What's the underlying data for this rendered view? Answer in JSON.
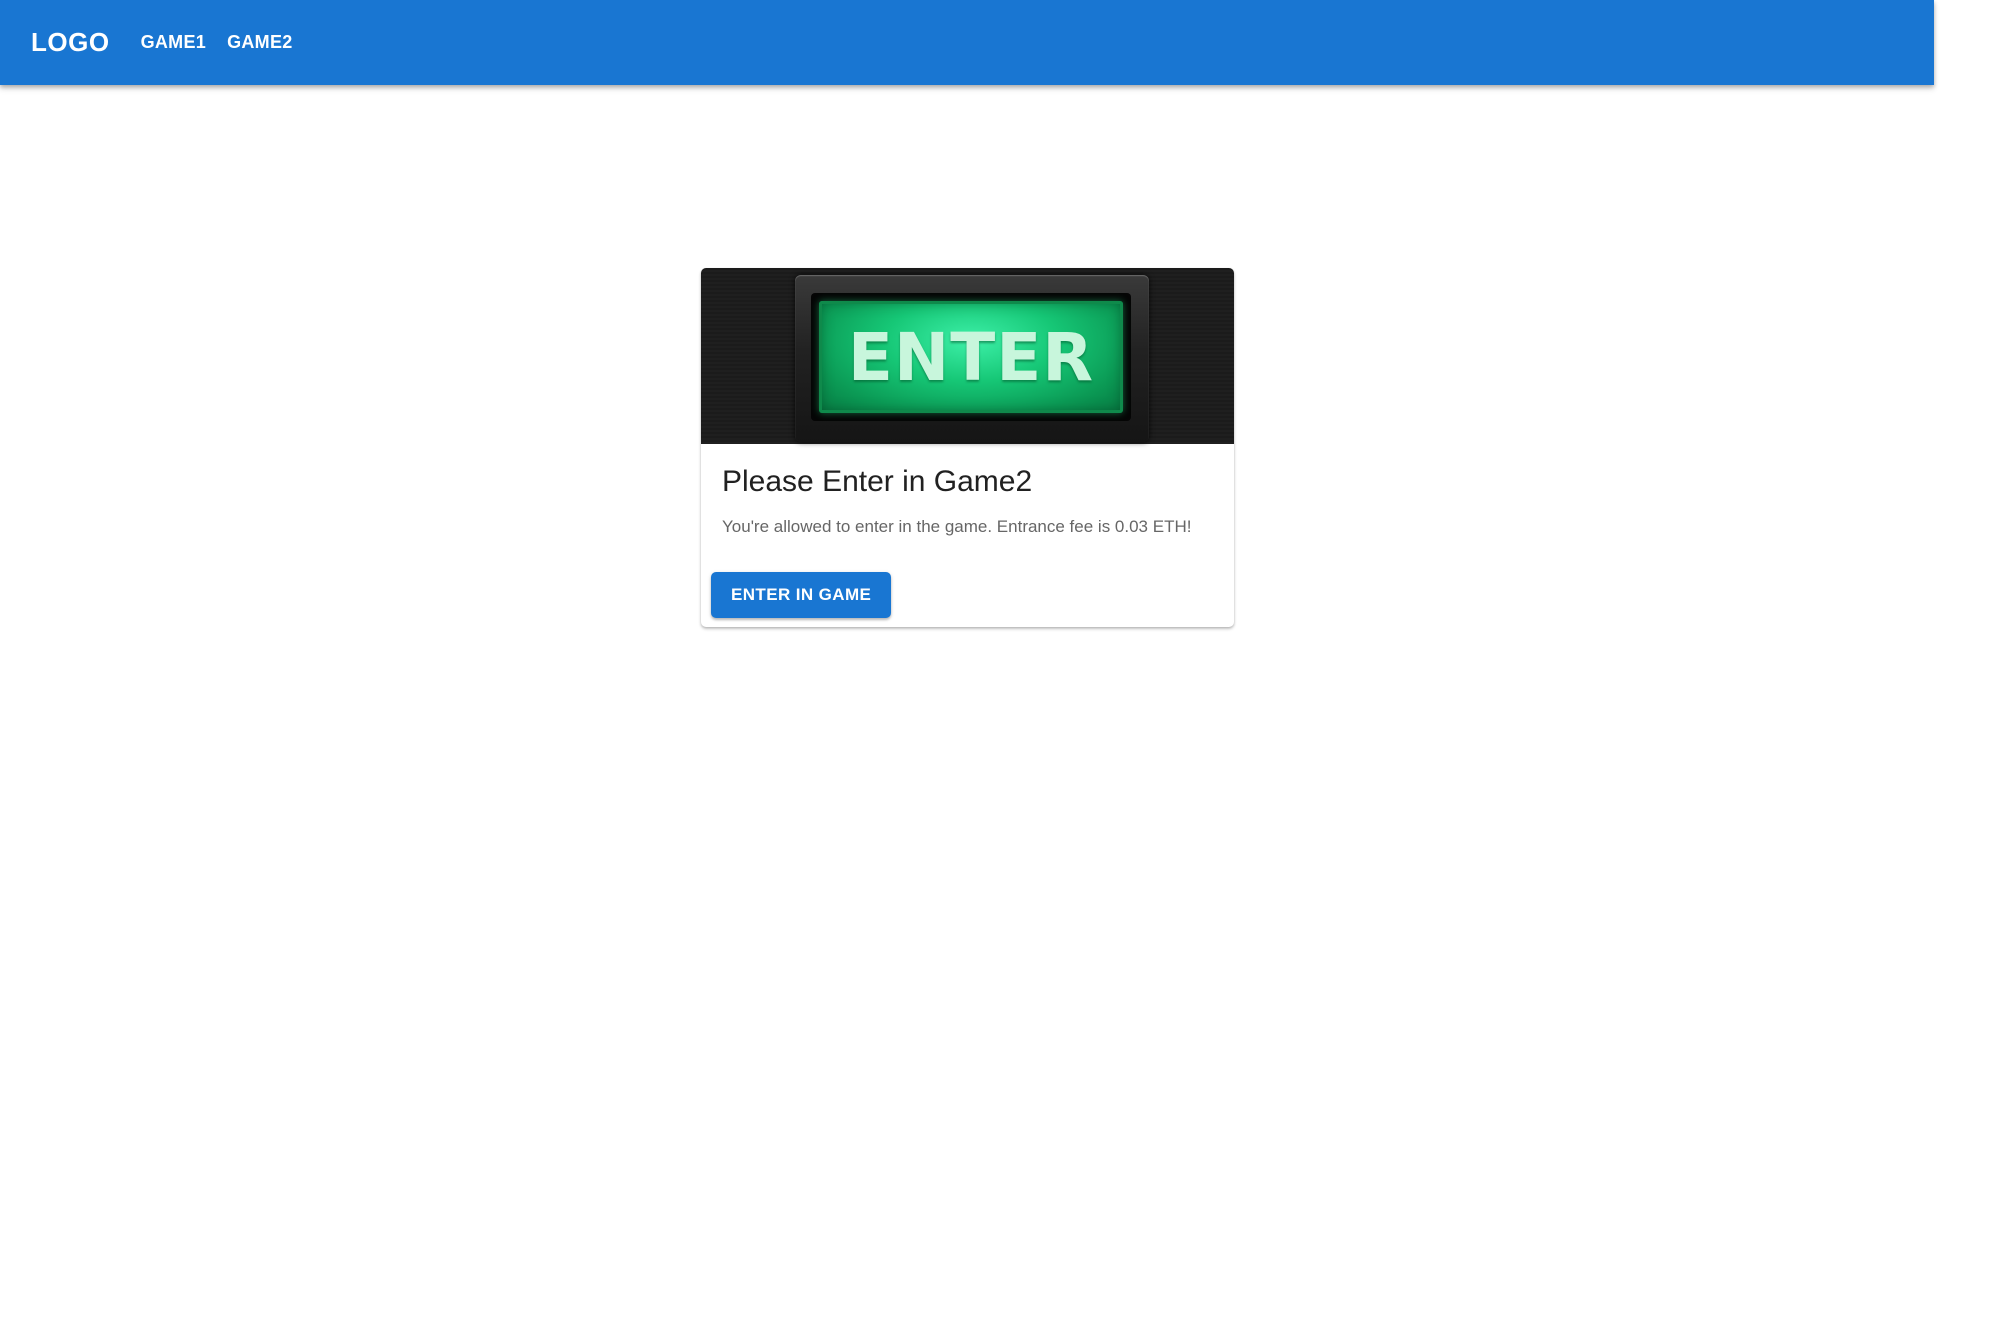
{
  "appbar": {
    "logo": "LOGO",
    "nav": [
      {
        "label": "GAME1"
      },
      {
        "label": "GAME2"
      }
    ],
    "color": "#1976d2"
  },
  "card": {
    "media_text": "ENTER",
    "title": "Please Enter in Game2",
    "text": "You're allowed to enter in the game. Entrance fee is 0.03 ETH!",
    "action_label": "ENTER IN GAME",
    "accent_color": "#1976d2",
    "button_image_color": "#16c776"
  }
}
